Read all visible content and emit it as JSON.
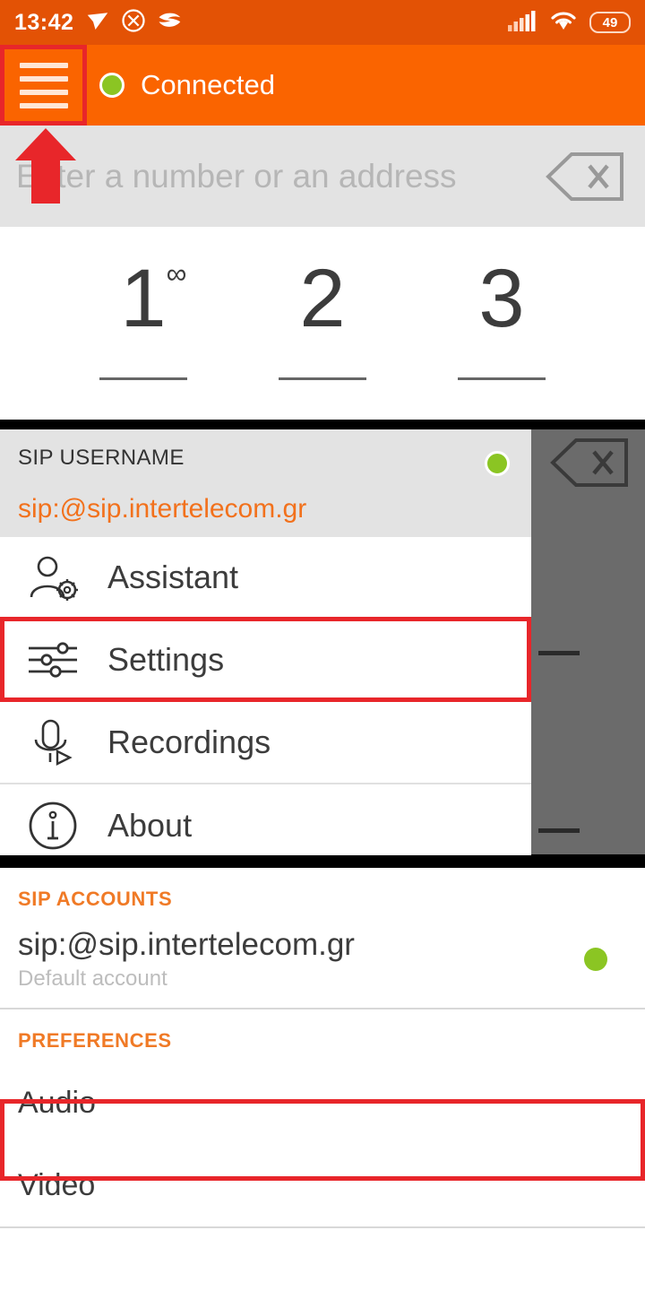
{
  "status_bar": {
    "clock": "13:42",
    "battery_percent": "49",
    "icons": [
      "location-arrow-icon",
      "no-entry-icon",
      "fish-icon",
      "cell-signal-icon",
      "wifi-icon"
    ],
    "background_color": "#E35205"
  },
  "toolbar": {
    "menu_icon": "hamburger-menu-icon",
    "status_text": "Connected",
    "status_color": "#8BC523",
    "background_color": "#FA6400"
  },
  "address_bar": {
    "value": "",
    "placeholder": "Enter a number or an address",
    "backspace_icon": "backspace-icon"
  },
  "dialpad": {
    "keys": [
      {
        "digit": "1",
        "sup": "∞",
        "has_underline": true
      },
      {
        "digit": "2",
        "sup": "",
        "has_underline": true
      },
      {
        "digit": "3",
        "sup": "",
        "has_underline": true
      }
    ]
  },
  "drawer": {
    "header": {
      "label": "SIP USERNAME",
      "value": "sip:@sip.intertelecom.gr",
      "value_color": "#F2711C",
      "status_dot_color": "#8BC523"
    },
    "items": [
      {
        "label": "Assistant",
        "icon": "person-gear-icon"
      },
      {
        "label": "Settings",
        "icon": "sliders-icon"
      },
      {
        "label": "Recordings",
        "icon": "microphone-play-icon"
      },
      {
        "label": "About",
        "icon": "info-circle-icon"
      }
    ]
  },
  "settings_page": {
    "accounts_header": "SIP ACCOUNTS",
    "accounts": [
      {
        "title": "sip:@sip.intertelecom.gr",
        "subtitle": "Default account",
        "status_color": "#8BC523"
      }
    ],
    "preferences_header": "PREFERENCES",
    "preferences": [
      {
        "label": "Audio"
      },
      {
        "label": "Video"
      }
    ]
  },
  "annotations": {
    "highlight_color": "#E8262A",
    "arrow_icon": "up-arrow-annotation",
    "boxes": [
      "hamburger-menu-icon",
      "Settings",
      "Audio"
    ]
  }
}
